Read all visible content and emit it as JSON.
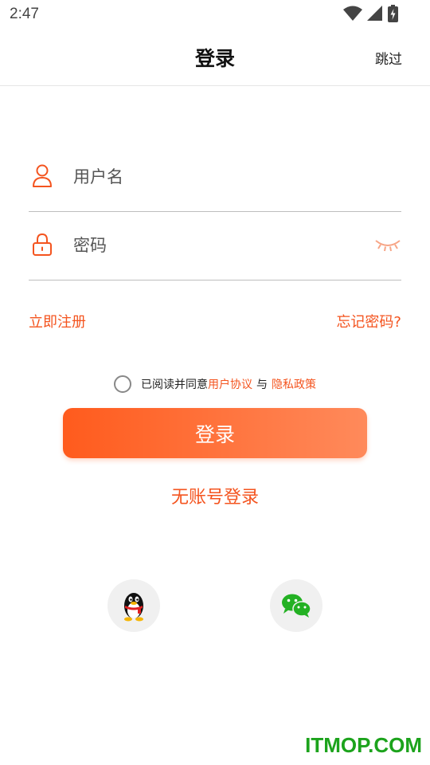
{
  "status_bar": {
    "time": "2:47"
  },
  "header": {
    "title": "登录",
    "skip_label": "跳过"
  },
  "form": {
    "username_placeholder": "用户名",
    "password_placeholder": "密码",
    "register_label": "立即注册",
    "forgot_label": "忘记密码?"
  },
  "agreement": {
    "prefix": "已阅读并同意",
    "user_agreement": "用户协议",
    "separator": "与",
    "privacy_policy": "隐私政策"
  },
  "login_button": "登录",
  "guest_login": "无账号登录",
  "social": [
    "qq-login",
    "wechat-login"
  ],
  "watermark": "ITMOP.COM",
  "colors": {
    "accent": "#f4541f",
    "gradient_start": "#ff5b1d",
    "gradient_end": "#ff8a5b"
  }
}
